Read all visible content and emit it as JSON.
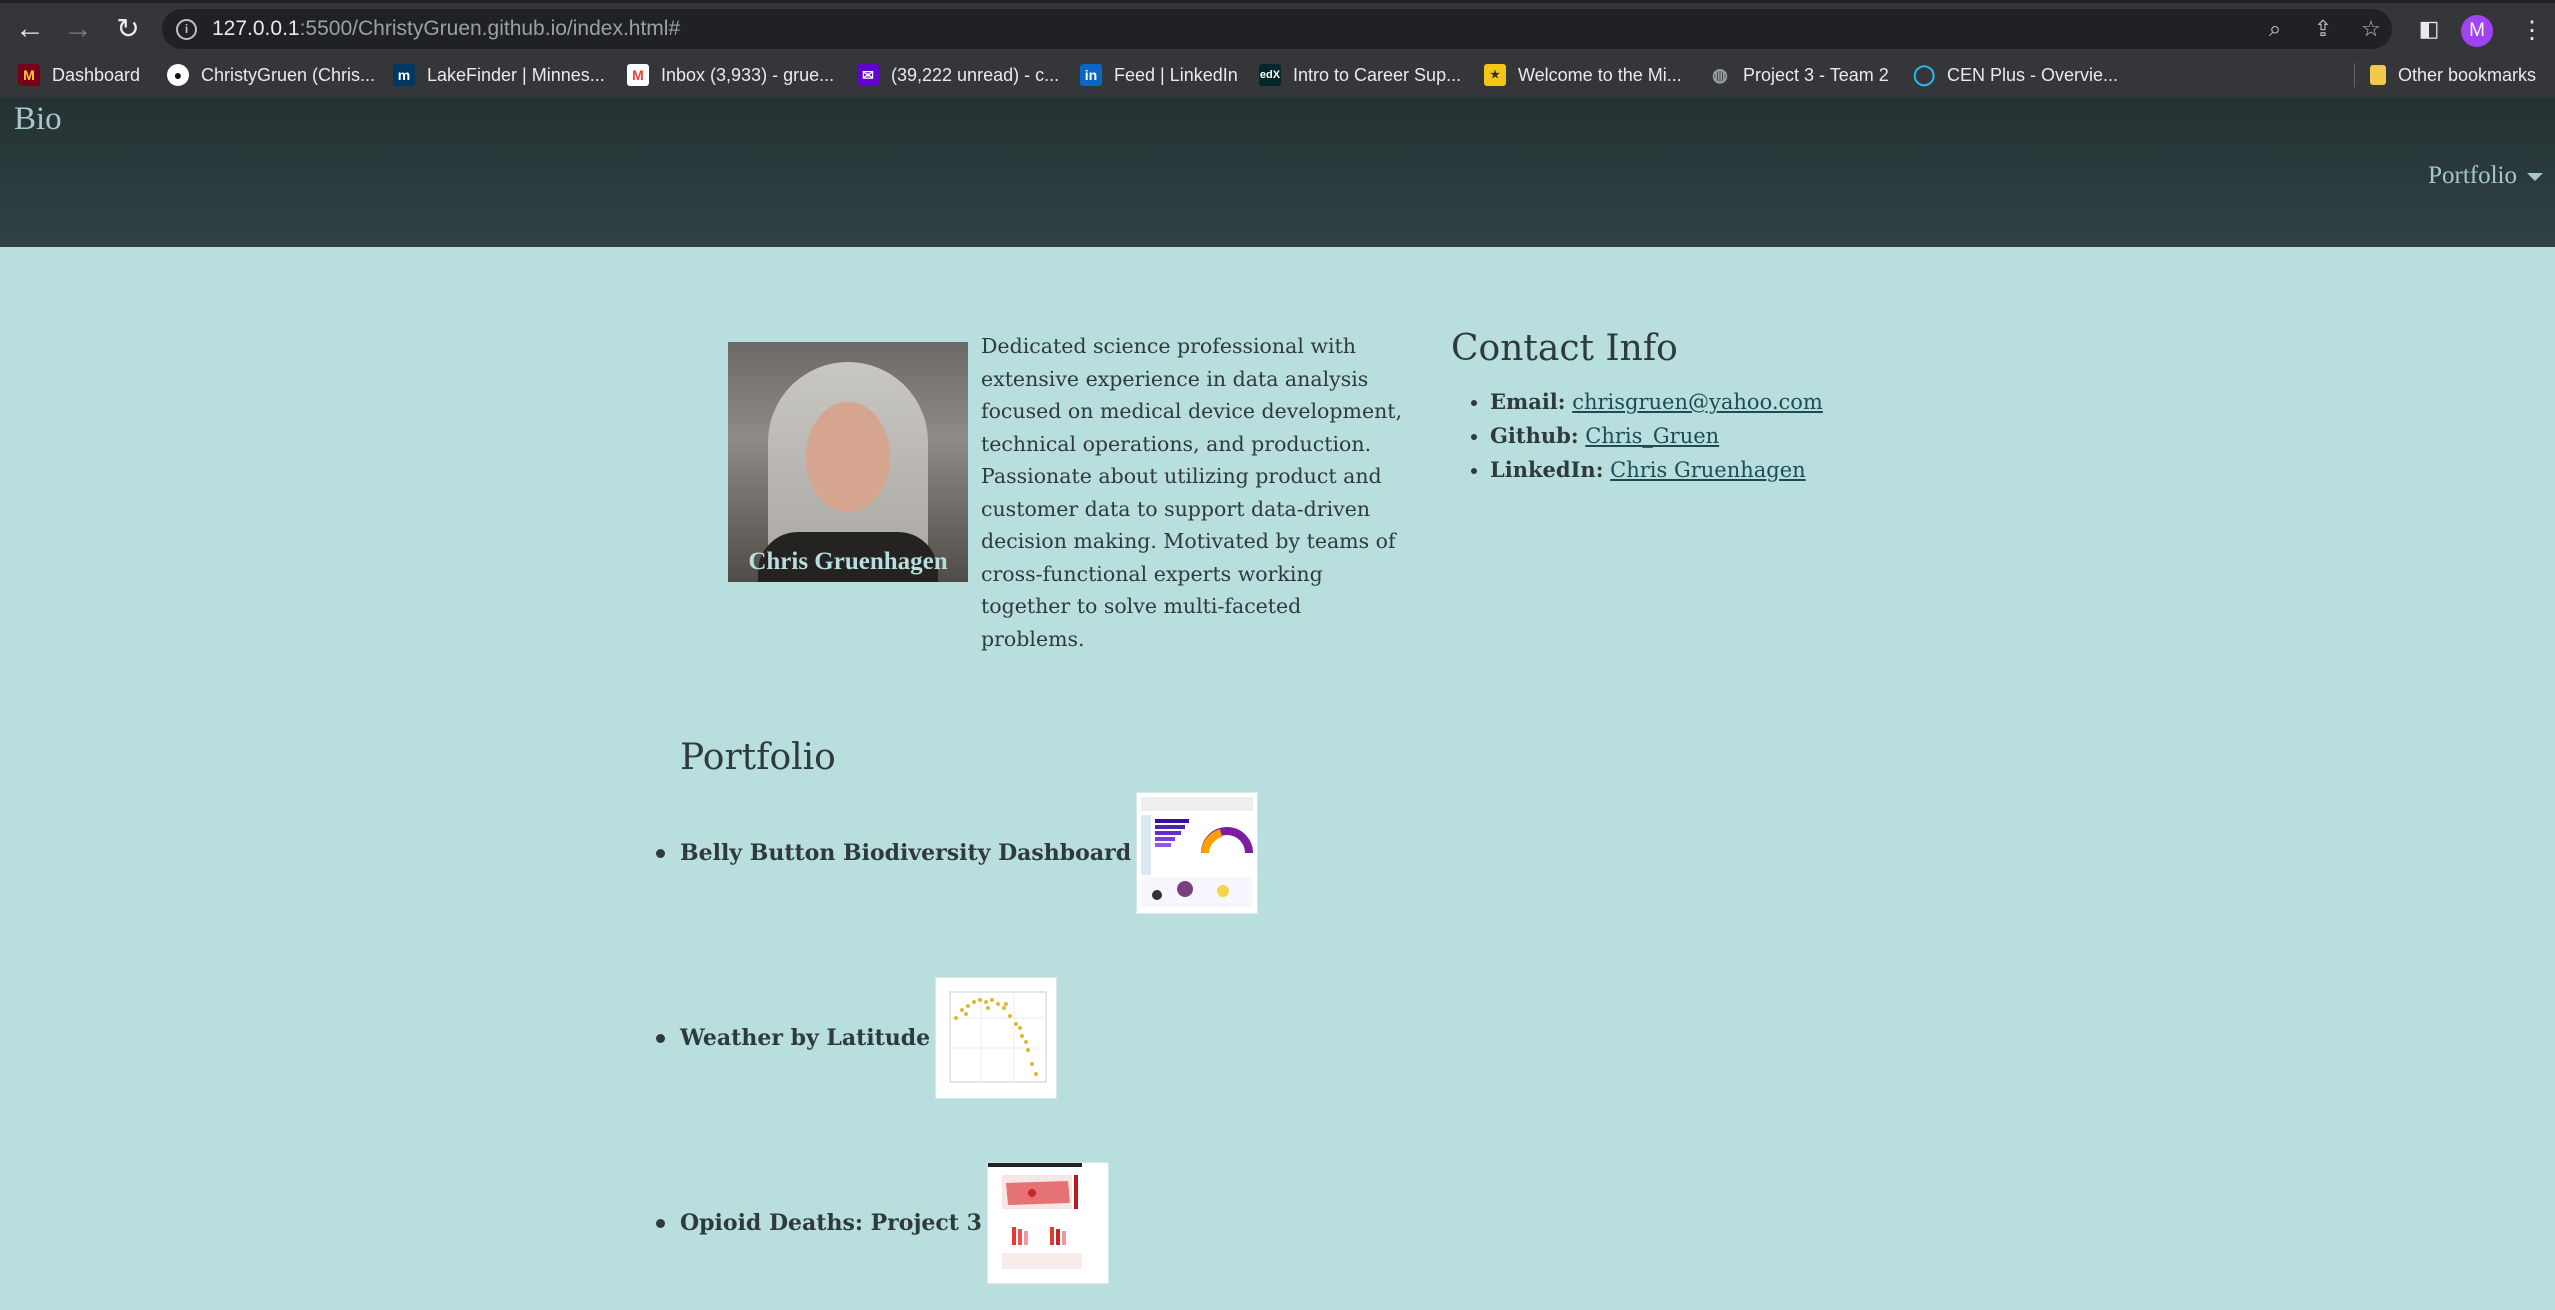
{
  "browser": {
    "url_host": "127.0.0.1",
    "url_rest": ":5500/ChristyGruen.github.io/index.html#",
    "avatar_letter": "M",
    "bookmarks": [
      {
        "label": "Dashboard",
        "icon": "umn-icon",
        "color": "#7a0019"
      },
      {
        "label": "ChristyGruen (Chris...",
        "icon": "github-icon",
        "color": "#ffffff"
      },
      {
        "label": "LakeFinder | Minnes...",
        "icon": "mn-icon",
        "color": "#003865"
      },
      {
        "label": "Inbox (3,933) - grue...",
        "icon": "gmail-icon",
        "color": "#ea4335"
      },
      {
        "label": "(39,222 unread) - c...",
        "icon": "yahoo-mail-icon",
        "color": "#6001d2"
      },
      {
        "label": "Feed | LinkedIn",
        "icon": "linkedin-icon",
        "color": "#0a66c2"
      },
      {
        "label": "Intro to Career Sup...",
        "icon": "edx-icon",
        "color": "#02262b"
      },
      {
        "label": "Welcome to the Mi...",
        "icon": "mn-star-icon",
        "color": "#f5c518"
      },
      {
        "label": "Project 3 - Team 2",
        "icon": "globe-icon",
        "color": "#9aa0a6"
      },
      {
        "label": "CEN Plus - Overvie...",
        "icon": "circle-icon",
        "color": "#29b6f6"
      }
    ],
    "other_bookmarks": "Other bookmarks"
  },
  "nav": {
    "brand": "Bio",
    "dropdown_label": "Portfolio"
  },
  "profile": {
    "photo_caption": "Chris Gruenhagen",
    "bio": "Dedicated science professional with extensive experience in data analysis focused on medical device development, technical operations, and production. Passionate about utilizing product and customer data to support data-driven decision making. Motivated by teams of cross-functional experts working together to solve multi-faceted problems."
  },
  "contact": {
    "title": "Contact Info",
    "email_label": "Email:",
    "email_value": "chrisgruen@yahoo.com",
    "github_label": "Github:",
    "github_value": "Chris_Gruen",
    "linkedin_label": "LinkedIn:",
    "linkedin_value": "Chris Gruenhagen"
  },
  "portfolio": {
    "title": "Portfolio",
    "items": [
      {
        "label": "Belly Button Biodiversity Dashboard"
      },
      {
        "label": "Weather by Latitude"
      },
      {
        "label": "Opioid Deaths: Project 3"
      }
    ]
  }
}
